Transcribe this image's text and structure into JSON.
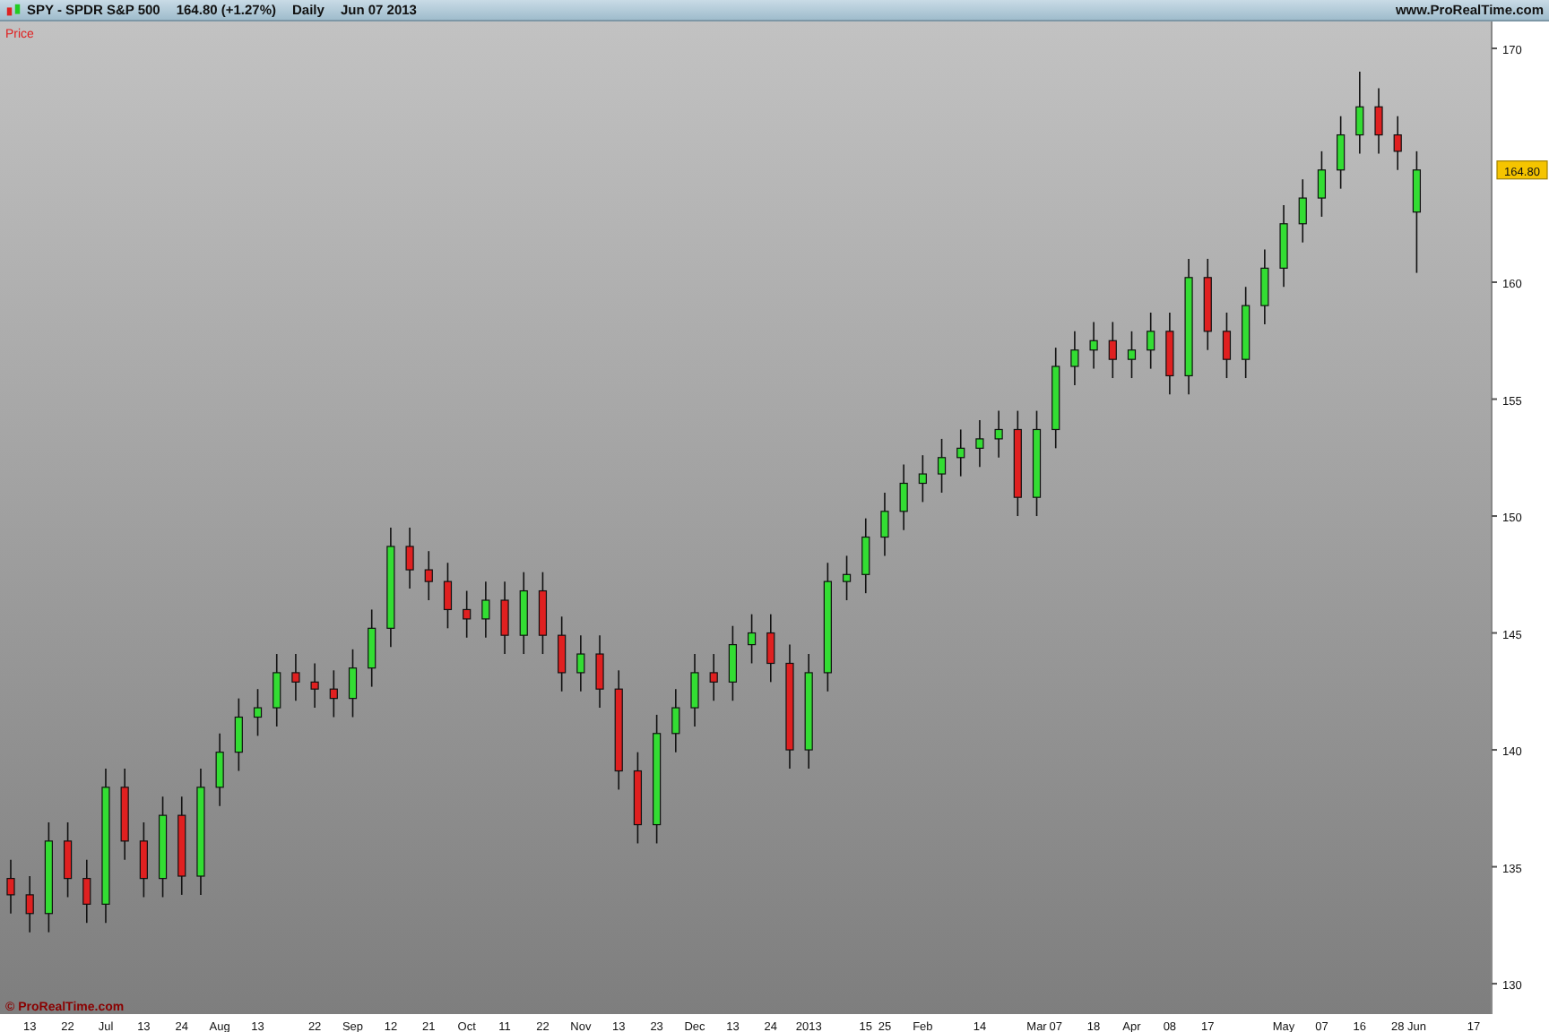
{
  "header": {
    "symbol": "SPY - SPDR S&P 500",
    "quote": "164.80 (+1.27%)",
    "period": "Daily",
    "date": "Jun 07 2013",
    "site": "www.ProRealTime.com"
  },
  "panel": {
    "label": "Price",
    "copyright": "© ProRealTime.com",
    "last_price": "164.80",
    "chart_data": {
      "type": "candlestick",
      "categories": [
        null,
        "13",
        null,
        "22",
        null,
        "Jul",
        null,
        "13",
        null,
        "24",
        null,
        "Aug",
        null,
        "13",
        null,
        null,
        "22",
        null,
        "Sep",
        null,
        "12",
        null,
        "21",
        null,
        "Oct",
        null,
        "11",
        null,
        "22",
        null,
        "Nov",
        null,
        "13",
        null,
        "23",
        null,
        "Dec",
        null,
        "13",
        null,
        "24",
        null,
        "2013",
        null,
        null,
        "15",
        "25",
        null,
        "Feb",
        null,
        null,
        "14",
        null,
        null,
        "Mar",
        "07",
        null,
        "18",
        null,
        "Apr",
        null,
        "08",
        null,
        "17",
        null,
        null,
        null,
        "May",
        null,
        "07",
        null,
        "16",
        null,
        "28",
        "Jun",
        null,
        null,
        "17"
      ],
      "ohlc": [
        [
          134.5,
          135.3,
          133.0,
          133.8
        ],
        [
          133.8,
          134.6,
          132.2,
          133.0
        ],
        [
          133.0,
          136.9,
          132.2,
          136.1
        ],
        [
          136.1,
          136.9,
          133.7,
          134.5
        ],
        [
          134.5,
          135.3,
          132.6,
          133.4
        ],
        [
          133.4,
          139.2,
          132.6,
          138.4
        ],
        [
          138.4,
          139.2,
          135.3,
          136.1
        ],
        [
          136.1,
          136.9,
          133.7,
          134.5
        ],
        [
          134.5,
          138.0,
          133.7,
          137.2
        ],
        [
          137.2,
          138.0,
          133.8,
          134.6
        ],
        [
          134.6,
          139.2,
          133.8,
          138.4
        ],
        [
          138.4,
          140.7,
          137.6,
          139.9
        ],
        [
          139.9,
          142.2,
          139.1,
          141.4
        ],
        [
          141.4,
          142.6,
          140.6,
          141.8
        ],
        [
          141.8,
          144.1,
          141.0,
          143.3
        ],
        [
          143.3,
          144.1,
          142.1,
          142.9
        ],
        [
          142.9,
          143.7,
          141.8,
          142.6
        ],
        [
          142.6,
          143.4,
          141.4,
          142.2
        ],
        [
          142.2,
          144.3,
          141.4,
          143.5
        ],
        [
          143.5,
          146.0,
          142.7,
          145.2
        ],
        [
          145.2,
          149.5,
          144.4,
          148.7
        ],
        [
          148.7,
          149.5,
          146.9,
          147.7
        ],
        [
          147.7,
          148.5,
          146.4,
          147.2
        ],
        [
          147.2,
          148.0,
          145.2,
          146.0
        ],
        [
          146.0,
          146.8,
          144.8,
          145.6
        ],
        [
          145.6,
          147.2,
          144.8,
          146.4
        ],
        [
          146.4,
          147.2,
          144.1,
          144.9
        ],
        [
          144.9,
          147.6,
          144.1,
          146.8
        ],
        [
          146.8,
          147.6,
          144.1,
          144.9
        ],
        [
          144.9,
          145.7,
          142.5,
          143.3
        ],
        [
          143.3,
          144.9,
          142.5,
          144.1
        ],
        [
          144.1,
          144.9,
          141.8,
          142.6
        ],
        [
          142.6,
          143.4,
          138.3,
          139.1
        ],
        [
          139.1,
          139.9,
          136.0,
          136.8
        ],
        [
          136.8,
          141.5,
          136.0,
          140.7
        ],
        [
          140.7,
          142.6,
          139.9,
          141.8
        ],
        [
          141.8,
          144.1,
          141.0,
          143.3
        ],
        [
          143.3,
          144.1,
          142.1,
          142.9
        ],
        [
          142.9,
          145.3,
          142.1,
          144.5
        ],
        [
          144.5,
          145.8,
          143.7,
          145.0
        ],
        [
          145.0,
          145.8,
          142.9,
          143.7
        ],
        [
          143.7,
          144.5,
          139.2,
          140.0
        ],
        [
          140.0,
          144.1,
          139.2,
          143.3
        ],
        [
          143.3,
          148.0,
          142.5,
          147.2
        ],
        [
          147.2,
          148.3,
          146.4,
          147.5
        ],
        [
          147.5,
          149.9,
          146.7,
          149.1
        ],
        [
          149.1,
          151.0,
          148.3,
          150.2
        ],
        [
          150.2,
          152.2,
          149.4,
          151.4
        ],
        [
          151.4,
          152.6,
          150.6,
          151.8
        ],
        [
          151.8,
          153.3,
          151.0,
          152.5
        ],
        [
          152.5,
          153.7,
          151.7,
          152.9
        ],
        [
          152.9,
          154.1,
          152.1,
          153.3
        ],
        [
          153.3,
          154.5,
          152.5,
          153.7
        ],
        [
          153.7,
          154.5,
          150.0,
          150.8
        ],
        [
          150.8,
          154.5,
          150.0,
          153.7
        ],
        [
          153.7,
          157.2,
          152.9,
          156.4
        ],
        [
          156.4,
          157.9,
          155.6,
          157.1
        ],
        [
          157.1,
          158.3,
          156.3,
          157.5
        ],
        [
          157.5,
          158.3,
          155.9,
          156.7
        ],
        [
          156.7,
          157.9,
          155.9,
          157.1
        ],
        [
          157.1,
          158.7,
          156.3,
          157.9
        ],
        [
          157.9,
          158.7,
          155.2,
          156.0
        ],
        [
          156.0,
          161.0,
          155.2,
          160.2
        ],
        [
          160.2,
          161.0,
          157.1,
          157.9
        ],
        [
          157.9,
          158.7,
          155.9,
          156.7
        ],
        [
          156.7,
          159.8,
          155.9,
          159.0
        ],
        [
          159.0,
          161.4,
          158.2,
          160.6
        ],
        [
          160.6,
          163.3,
          159.8,
          162.5
        ],
        [
          162.5,
          164.4,
          161.7,
          163.6
        ],
        [
          163.6,
          165.6,
          162.8,
          164.8
        ],
        [
          164.8,
          167.1,
          164.0,
          166.3
        ],
        [
          166.3,
          169.0,
          165.5,
          167.5
        ],
        [
          167.5,
          168.3,
          165.5,
          166.3
        ],
        [
          166.3,
          167.1,
          164.8,
          165.6
        ],
        [
          163.0,
          165.6,
          160.4,
          164.8
        ],
        null,
        null,
        null
      ],
      "ylim": [
        128.7,
        171.15
      ],
      "yticks": [
        130,
        135,
        140,
        145,
        150,
        155,
        160,
        170
      ]
    }
  }
}
